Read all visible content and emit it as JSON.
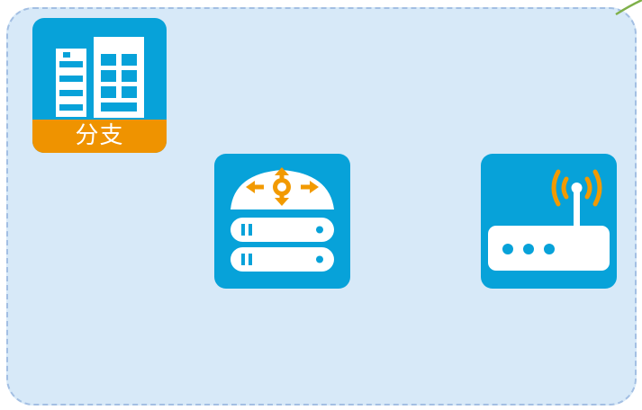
{
  "diagram": {
    "zone": {
      "fill_color": "#d7e9f8",
      "border_color": "#a3bfe3",
      "border_style": "dashed"
    },
    "nodes": [
      {
        "id": "branch-office",
        "icon": "office-buildings-icon",
        "label": "分支",
        "tile_color": "#07a2d9",
        "label_band_color": "#ef9300"
      },
      {
        "id": "layer3-switch",
        "icon": "core-switch-icon",
        "label": "",
        "tile_color": "#07a2d9",
        "accent_color": "#f29a00"
      },
      {
        "id": "wireless-router",
        "icon": "wifi-router-icon",
        "label": "",
        "tile_color": "#07a2d9",
        "accent_color": "#f29a00"
      }
    ],
    "connector_color": "#7fb04a"
  }
}
